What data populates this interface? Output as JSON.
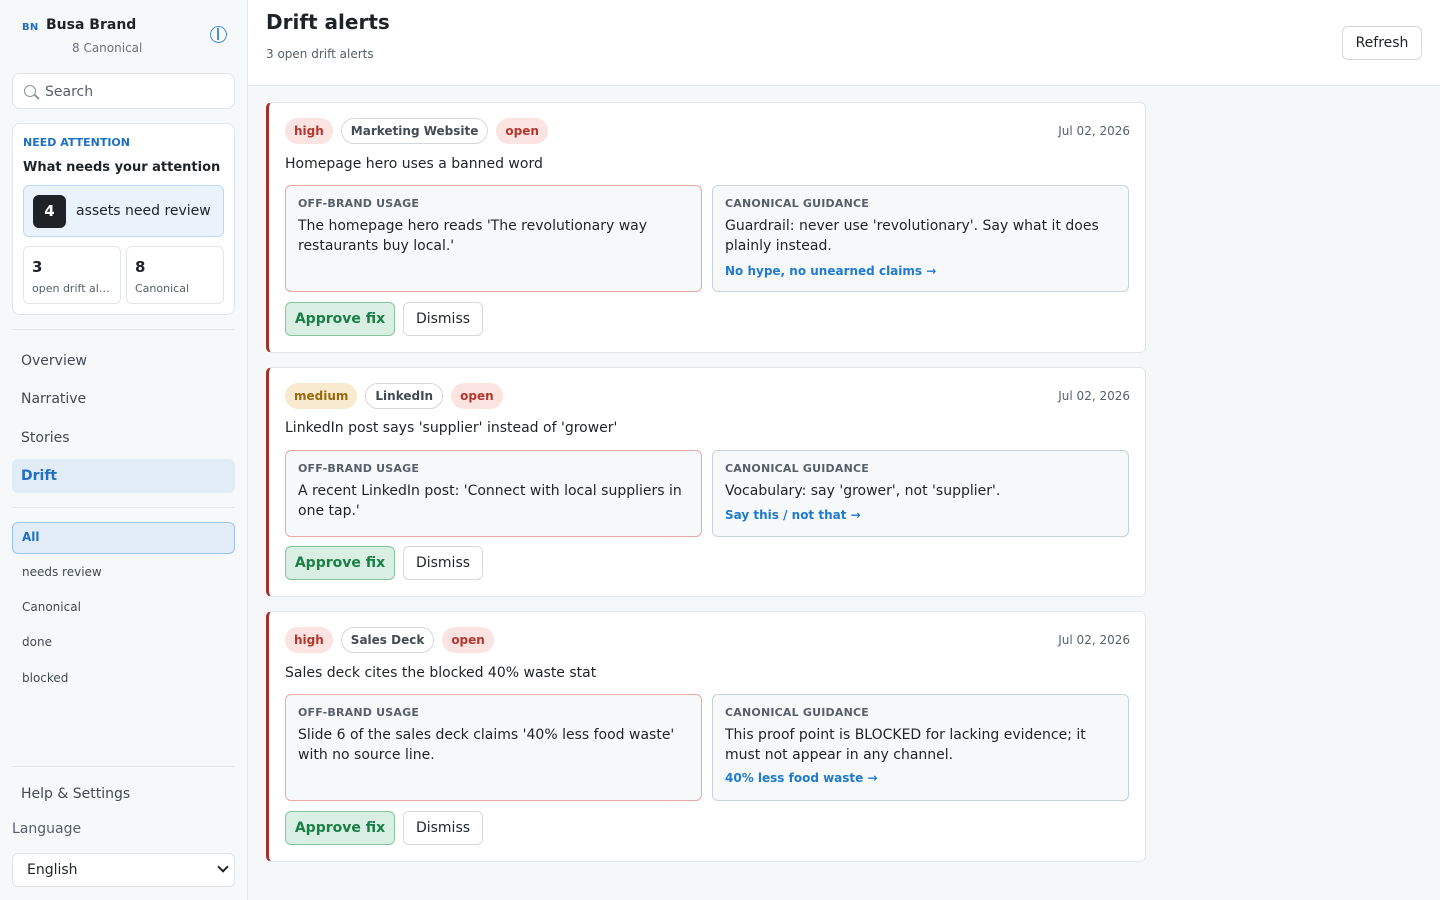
{
  "sidebar": {
    "brand": {
      "logo": "BN",
      "name": "Busa Brand",
      "subtitle": "8 Canonical"
    },
    "search": {
      "placeholder": "Search",
      "value": ""
    },
    "attention": {
      "eyebrow": "NEED ATTENTION",
      "title": "What needs your attention",
      "review_count": "4",
      "review_label": "assets need review",
      "stats": [
        {
          "value": "3",
          "label": "open drift alerts"
        },
        {
          "value": "8",
          "label": "Canonical"
        }
      ]
    },
    "nav": [
      {
        "label": "Overview",
        "active": false
      },
      {
        "label": "Narrative",
        "active": false
      },
      {
        "label": "Stories",
        "active": false
      },
      {
        "label": "Drift",
        "active": true
      }
    ],
    "filters": [
      {
        "label": "All",
        "active": true
      },
      {
        "label": "needs review",
        "active": false
      },
      {
        "label": "Canonical",
        "active": false
      },
      {
        "label": "done",
        "active": false
      },
      {
        "label": "blocked",
        "active": false
      }
    ],
    "help_label": "Help & Settings",
    "language_label": "Language",
    "language_value": "English"
  },
  "header": {
    "title": "Drift alerts",
    "subtitle": "3 open drift alerts",
    "refresh_label": "Refresh"
  },
  "labels": {
    "off_brand": "OFF-BRAND USAGE",
    "canonical": "CANONICAL GUIDANCE",
    "approve": "Approve fix",
    "dismiss": "Dismiss"
  },
  "alerts": [
    {
      "severity": "high",
      "channel": "Marketing Website",
      "status": "open",
      "date": "Jul 02, 2026",
      "title": "Homepage hero uses a banned word",
      "off_brand": "The homepage hero reads 'The revolutionary way restaurants buy local.'",
      "guidance": "Guardrail: never use 'revolutionary'. Say what it does plainly instead.",
      "link": "No hype, no unearned claims →"
    },
    {
      "severity": "medium",
      "channel": "LinkedIn",
      "status": "open",
      "date": "Jul 02, 2026",
      "title": "LinkedIn post says 'supplier' instead of 'grower'",
      "off_brand": "A recent LinkedIn post: 'Connect with local suppliers in one tap.'",
      "guidance": "Vocabulary: say 'grower', not 'supplier'.",
      "link": "Say this / not that →"
    },
    {
      "severity": "high",
      "channel": "Sales Deck",
      "status": "open",
      "date": "Jul 02, 2026",
      "title": "Sales deck cites the blocked 40% waste stat",
      "off_brand": "Slide 6 of the sales deck claims '40% less food waste' with no source line.",
      "guidance": "This proof point is BLOCKED for lacking evidence; it must not appear in any channel.",
      "link": "40% less food waste →"
    }
  ],
  "colors": {
    "accent": "#1f6fc5",
    "alert_border": "#a3312b",
    "approve_text": "#1a7f46",
    "high_bg": "#fbe3e1",
    "medium_bg": "#f8ead0"
  }
}
